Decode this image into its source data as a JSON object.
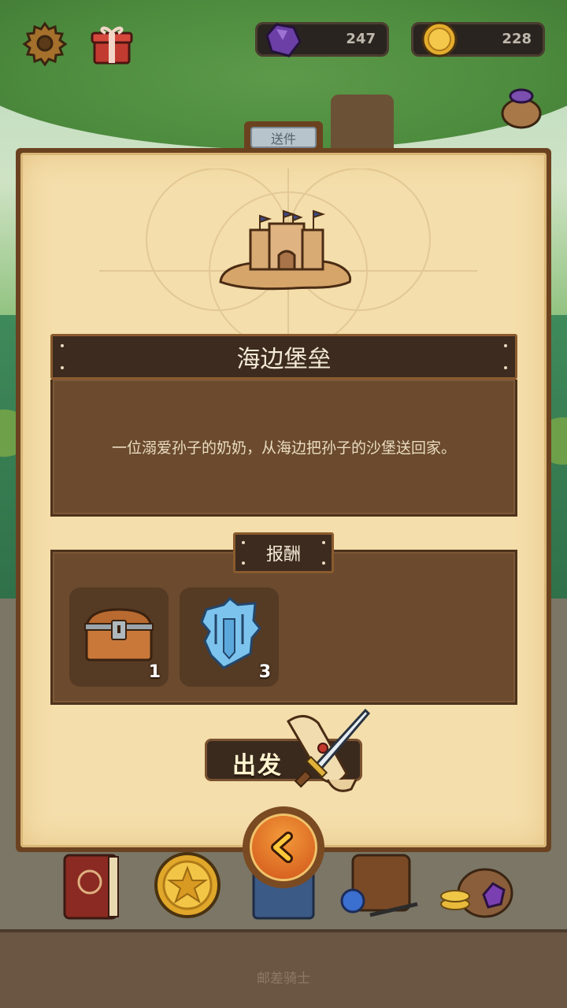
{
  "hud": {
    "gems": "247",
    "coins": "228",
    "icons": [
      "gear-icon",
      "gift-icon",
      "gem-icon",
      "coin-icon",
      "sack-icon"
    ]
  },
  "panel": {
    "tab_label": "送件",
    "quest_title": "海边堡垒",
    "quest_description": "一位溺爱孙子的奶奶，从海边把孙子的沙堡送回家。",
    "rewards_label": "报酬",
    "rewards": [
      {
        "icon": "treasure-chest-icon",
        "quantity": "1"
      },
      {
        "icon": "blue-shield-shard-icon",
        "quantity": "3"
      }
    ],
    "go_button": "出发",
    "back_icon": "chevron-left-icon"
  },
  "bottom": {
    "tab_label": "邮差骑士",
    "dock_icons": [
      "book-icon",
      "star-coin-icon",
      "journal-icon",
      "backpack-icon",
      "treasure-sack-icon"
    ]
  },
  "colors": {
    "panel_frame": "#6b4220",
    "parchment": "#f4deab",
    "dark_box": "#6b4a2e",
    "back_button": "#e0702a"
  }
}
